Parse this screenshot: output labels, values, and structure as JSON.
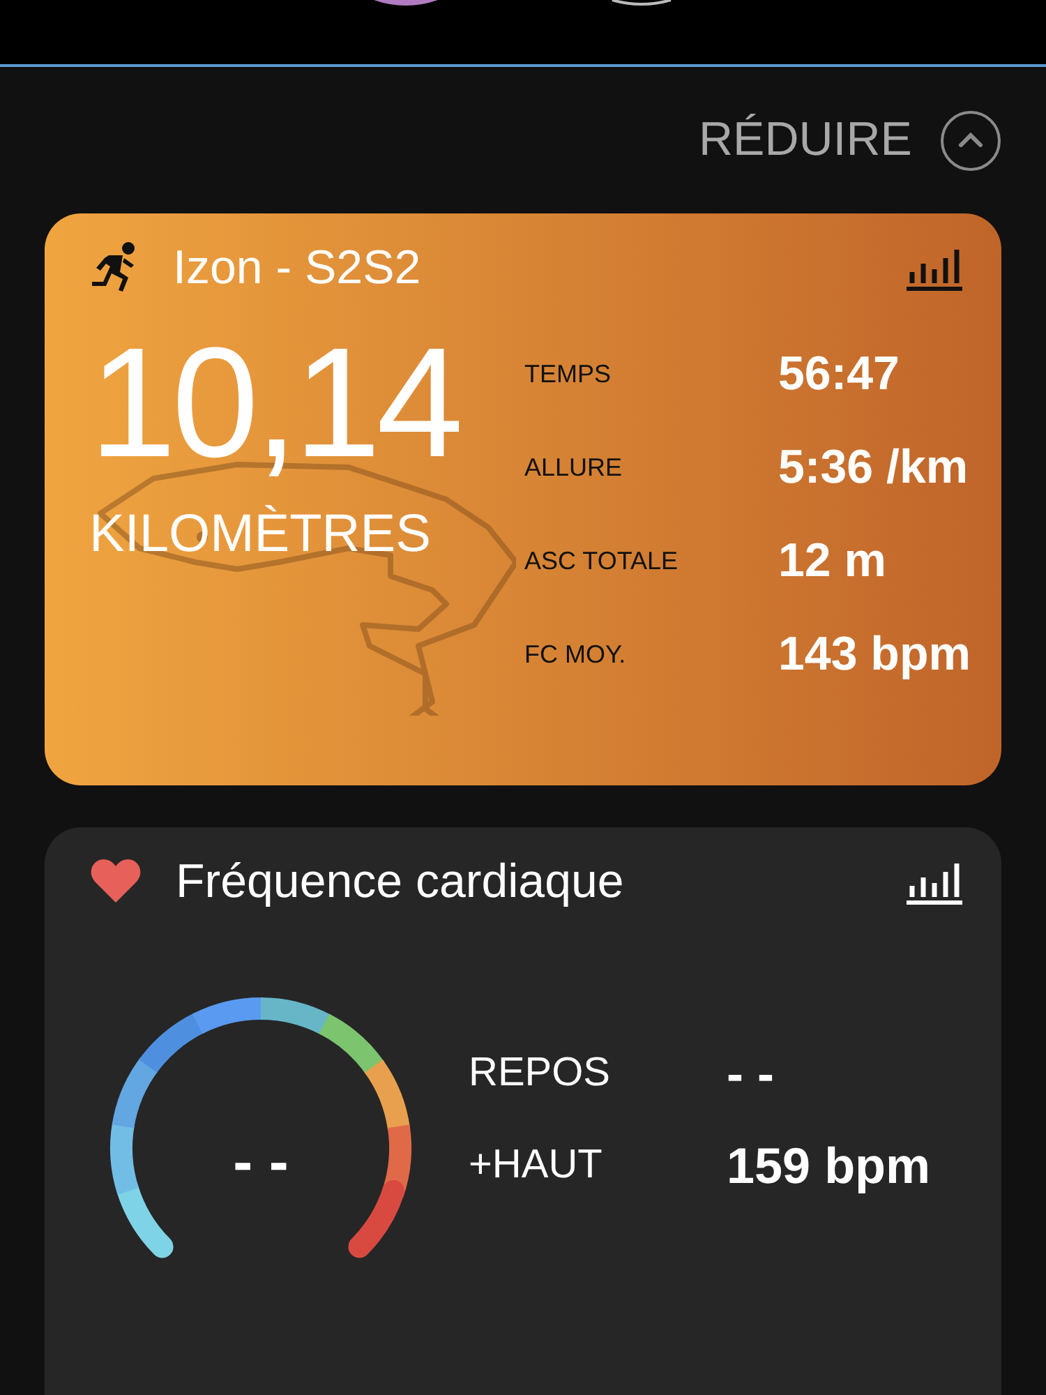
{
  "collapse": {
    "label": "RÉDUIRE"
  },
  "activity": {
    "title": "Izon - S2S2",
    "distance": "10,14",
    "unit": "KILOMÈTRES",
    "stats": [
      {
        "label": "TEMPS",
        "value": "56:47"
      },
      {
        "label": "ALLURE",
        "value": "5:36 /km"
      },
      {
        "label": "ASC TOTALE",
        "value": "12 m"
      },
      {
        "label": "FC MOY.",
        "value": "143 bpm"
      }
    ]
  },
  "heart_rate": {
    "title": "Fréquence cardiaque",
    "gauge_value": "- -",
    "stats": [
      {
        "label": "REPOS",
        "value": "- -"
      },
      {
        "label": "+HAUT",
        "value": "159 bpm"
      }
    ]
  }
}
